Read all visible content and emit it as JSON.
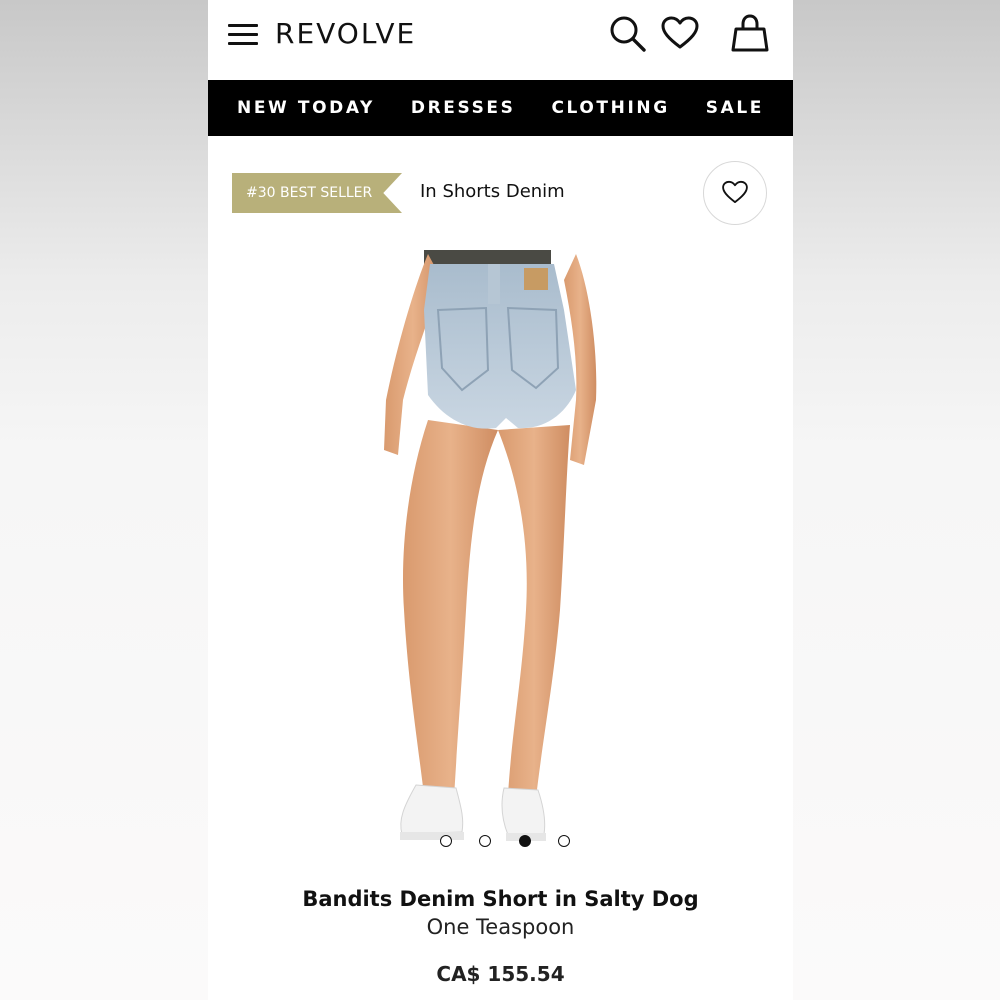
{
  "header": {
    "logo": "REVOLVE",
    "icons": [
      "menu-icon",
      "search-icon",
      "heart-icon",
      "shopping-bag-icon"
    ]
  },
  "nav": {
    "items": [
      "NEW TODAY",
      "DRESSES",
      "CLOTHING",
      "SALE"
    ]
  },
  "badge": {
    "text": "#30 BEST SELLER",
    "color": "#b8b07a"
  },
  "category": {
    "text": "In Shorts Denim"
  },
  "carousel": {
    "total": 4,
    "active_index": 3
  },
  "product": {
    "name": "Bandits Denim Short in Salty Dog",
    "brand": "One Teaspoon",
    "price": "CA$ 155.54"
  },
  "colors": {
    "nav_background": "#000000",
    "badge": "#b8b07a",
    "text": "#111111"
  }
}
